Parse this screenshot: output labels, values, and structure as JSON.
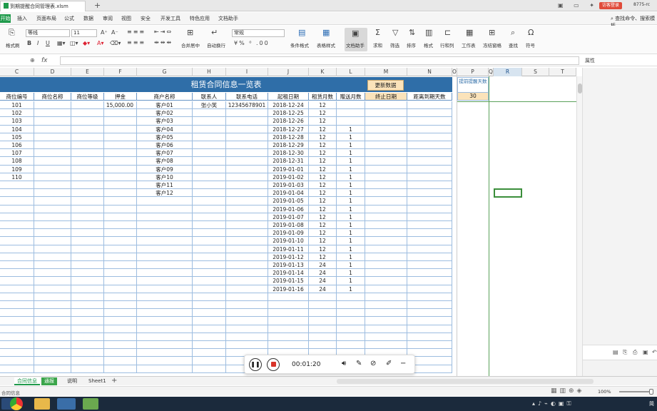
{
  "titlebar": {
    "doc_title": "到期提醒合同管理表.xlsm",
    "new_tab": "+",
    "login_button": "访客登录",
    "user_id": "8775-rc"
  },
  "menubar": {
    "start": "开始",
    "items": [
      "插入",
      "页面布局",
      "公式",
      "数据",
      "审阅",
      "视图",
      "安全",
      "开发工具",
      "特色应用",
      "文档助手"
    ],
    "search_label": "查找命令、搜索模板"
  },
  "toolbar": {
    "font_name": "等线",
    "font_size": "11",
    "number_format": "常规",
    "format_painter": "格式刷",
    "merge_center": "合并居中",
    "wrap_text": "自动换行",
    "conditional_format": "条件格式",
    "table_style": "表格样式",
    "doc_helper": "文档助手",
    "sum": "求和",
    "filter": "筛选",
    "sort": "排序",
    "format": "格式",
    "row_col": "行和列",
    "worksheet": "工作表",
    "freeze": "冻结窗格",
    "find": "查找",
    "symbol": "符号",
    "bold": "B",
    "italic": "I",
    "underline": "U",
    "font_grow": "A⁺",
    "font_shrink": "A⁻"
  },
  "formula_bar": {
    "fx": "fx",
    "property_label": "属性"
  },
  "columns": [
    "C",
    "D",
    "E",
    "F",
    "G",
    "H",
    "I",
    "J",
    "K",
    "L",
    "M",
    "N",
    "O",
    "P",
    "Q",
    "R",
    "S",
    "T"
  ],
  "sheet": {
    "banner_title": "租赁合同信息一览表",
    "update_button": "更新数据",
    "headers": [
      "商位编号",
      "商位名称",
      "商位等级",
      "押金",
      "商户名称",
      "联系人",
      "联系电话",
      "起租日期",
      "租赁月数",
      "赠送月数",
      "终止日期",
      "距离到期天数"
    ],
    "rows": [
      [
        "101",
        "",
        "",
        "15,000.00",
        "客户01",
        "张小笑",
        "12345678901",
        "2018-12-24",
        "12",
        ""
      ],
      [
        "102",
        "",
        "",
        "",
        "客户02",
        "",
        "",
        "2018-12-25",
        "12",
        ""
      ],
      [
        "103",
        "",
        "",
        "",
        "客户03",
        "",
        "",
        "2018-12-26",
        "12",
        ""
      ],
      [
        "104",
        "",
        "",
        "",
        "客户04",
        "",
        "",
        "2018-12-27",
        "12",
        "1"
      ],
      [
        "105",
        "",
        "",
        "",
        "客户05",
        "",
        "",
        "2018-12-28",
        "12",
        "1"
      ],
      [
        "106",
        "",
        "",
        "",
        "客户06",
        "",
        "",
        "2018-12-29",
        "12",
        "1"
      ],
      [
        "107",
        "",
        "",
        "",
        "客户07",
        "",
        "",
        "2018-12-30",
        "12",
        "1"
      ],
      [
        "108",
        "",
        "",
        "",
        "客户08",
        "",
        "",
        "2018-12-31",
        "12",
        "1"
      ],
      [
        "109",
        "",
        "",
        "",
        "客户09",
        "",
        "",
        "2019-01-01",
        "12",
        "1"
      ],
      [
        "110",
        "",
        "",
        "",
        "客户10",
        "",
        "",
        "2019-01-02",
        "12",
        "1"
      ],
      [
        "",
        "",
        "",
        "",
        "客户11",
        "",
        "",
        "2019-01-03",
        "12",
        "1"
      ],
      [
        "",
        "",
        "",
        "",
        "客户12",
        "",
        "",
        "2019-01-04",
        "12",
        "1"
      ],
      [
        "",
        "",
        "",
        "",
        "",
        "",
        "",
        "2019-01-05",
        "12",
        "1"
      ],
      [
        "",
        "",
        "",
        "",
        "",
        "",
        "",
        "2019-01-06",
        "12",
        "1"
      ],
      [
        "",
        "",
        "",
        "",
        "",
        "",
        "",
        "2019-01-07",
        "12",
        "1"
      ],
      [
        "",
        "",
        "",
        "",
        "",
        "",
        "",
        "2019-01-08",
        "12",
        "1"
      ],
      [
        "",
        "",
        "",
        "",
        "",
        "",
        "",
        "2019-01-09",
        "12",
        "1"
      ],
      [
        "",
        "",
        "",
        "",
        "",
        "",
        "",
        "2019-01-10",
        "12",
        "1"
      ],
      [
        "",
        "",
        "",
        "",
        "",
        "",
        "",
        "2019-01-11",
        "12",
        "1"
      ],
      [
        "",
        "",
        "",
        "",
        "",
        "",
        "",
        "2019-01-12",
        "12",
        "1"
      ],
      [
        "",
        "",
        "",
        "",
        "",
        "",
        "",
        "2019-01-13",
        "24",
        "1"
      ],
      [
        "",
        "",
        "",
        "",
        "",
        "",
        "",
        "2019-01-14",
        "24",
        "1"
      ],
      [
        "",
        "",
        "",
        "",
        "",
        "",
        "",
        "2019-01-15",
        "24",
        "1"
      ],
      [
        "",
        "",
        "",
        "",
        "",
        "",
        "",
        "2019-01-16",
        "24",
        "1"
      ]
    ],
    "reminder_label": "提前提醒天数",
    "reminder_value": "30"
  },
  "sheet_tabs": [
    "合同信息",
    "通报",
    "说明",
    "Sheet1"
  ],
  "active_tab": "合同信息",
  "statusbar": {
    "status": "合同信息",
    "zoom": "100%"
  },
  "recorder": {
    "time": "00:01:20"
  },
  "taskbar": {
    "clock": "简"
  },
  "colors": {
    "banner": "#2f6ea8",
    "accent_orange": "#fbe3ba",
    "wps_green": "#1f9a4b",
    "grid_line": "#9dbde0"
  }
}
